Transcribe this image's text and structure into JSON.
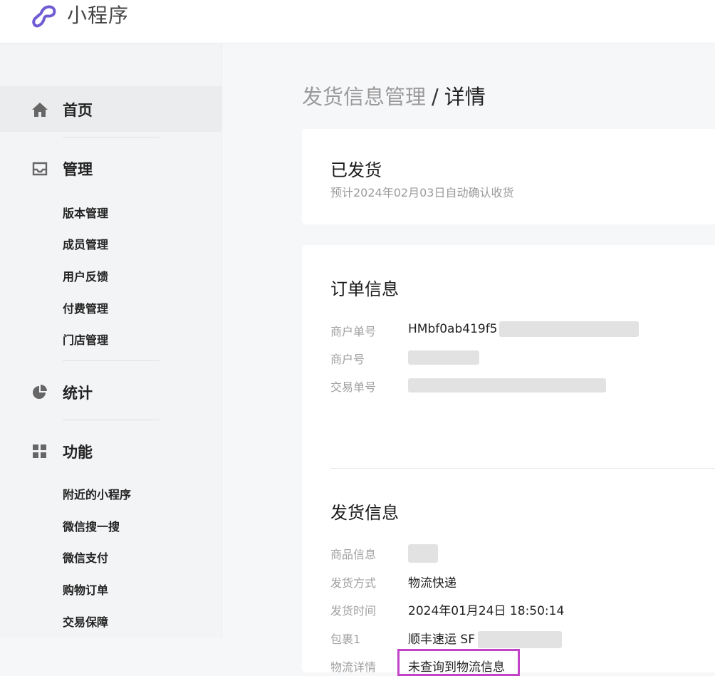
{
  "app": {
    "title": "小程序"
  },
  "sidebar": {
    "groups": [
      {
        "label": "首页",
        "icon": "home-icon",
        "items": []
      },
      {
        "label": "管理",
        "icon": "inbox-icon",
        "items": [
          "版本管理",
          "成员管理",
          "用户反馈",
          "付费管理",
          "门店管理"
        ]
      },
      {
        "label": "统计",
        "icon": "pie-chart-icon",
        "items": []
      },
      {
        "label": "功能",
        "icon": "grid-icon",
        "items": [
          "附近的小程序",
          "微信搜一搜",
          "微信支付",
          "购物订单",
          "交易保障"
        ]
      }
    ]
  },
  "breadcrumb": {
    "parent": "发货信息管理",
    "separator": "/",
    "current": "详情"
  },
  "status": {
    "title": "已发货",
    "subtitle": "预计2024年02月03日自动确认收货"
  },
  "order_info": {
    "title": "订单信息",
    "rows": [
      {
        "label": "商户单号",
        "value": "HMbf0ab419f5"
      },
      {
        "label": "商户号",
        "value": ""
      },
      {
        "label": "交易单号",
        "value": ""
      }
    ]
  },
  "shipping_info": {
    "title": "发货信息",
    "rows": [
      {
        "label": "商品信息",
        "value": ""
      },
      {
        "label": "发货方式",
        "value": "物流快递"
      },
      {
        "label": "发货时间",
        "value": "2024年01月24日 18:50:14"
      },
      {
        "label": "包裹1",
        "value": "顺丰速运 SF"
      },
      {
        "label": "物流详情",
        "value": "未查询到物流信息"
      }
    ]
  },
  "colors": {
    "brand": "#6f5bd3",
    "highlight": "#c243c8",
    "sidebar_bg": "#f3f4f6"
  }
}
